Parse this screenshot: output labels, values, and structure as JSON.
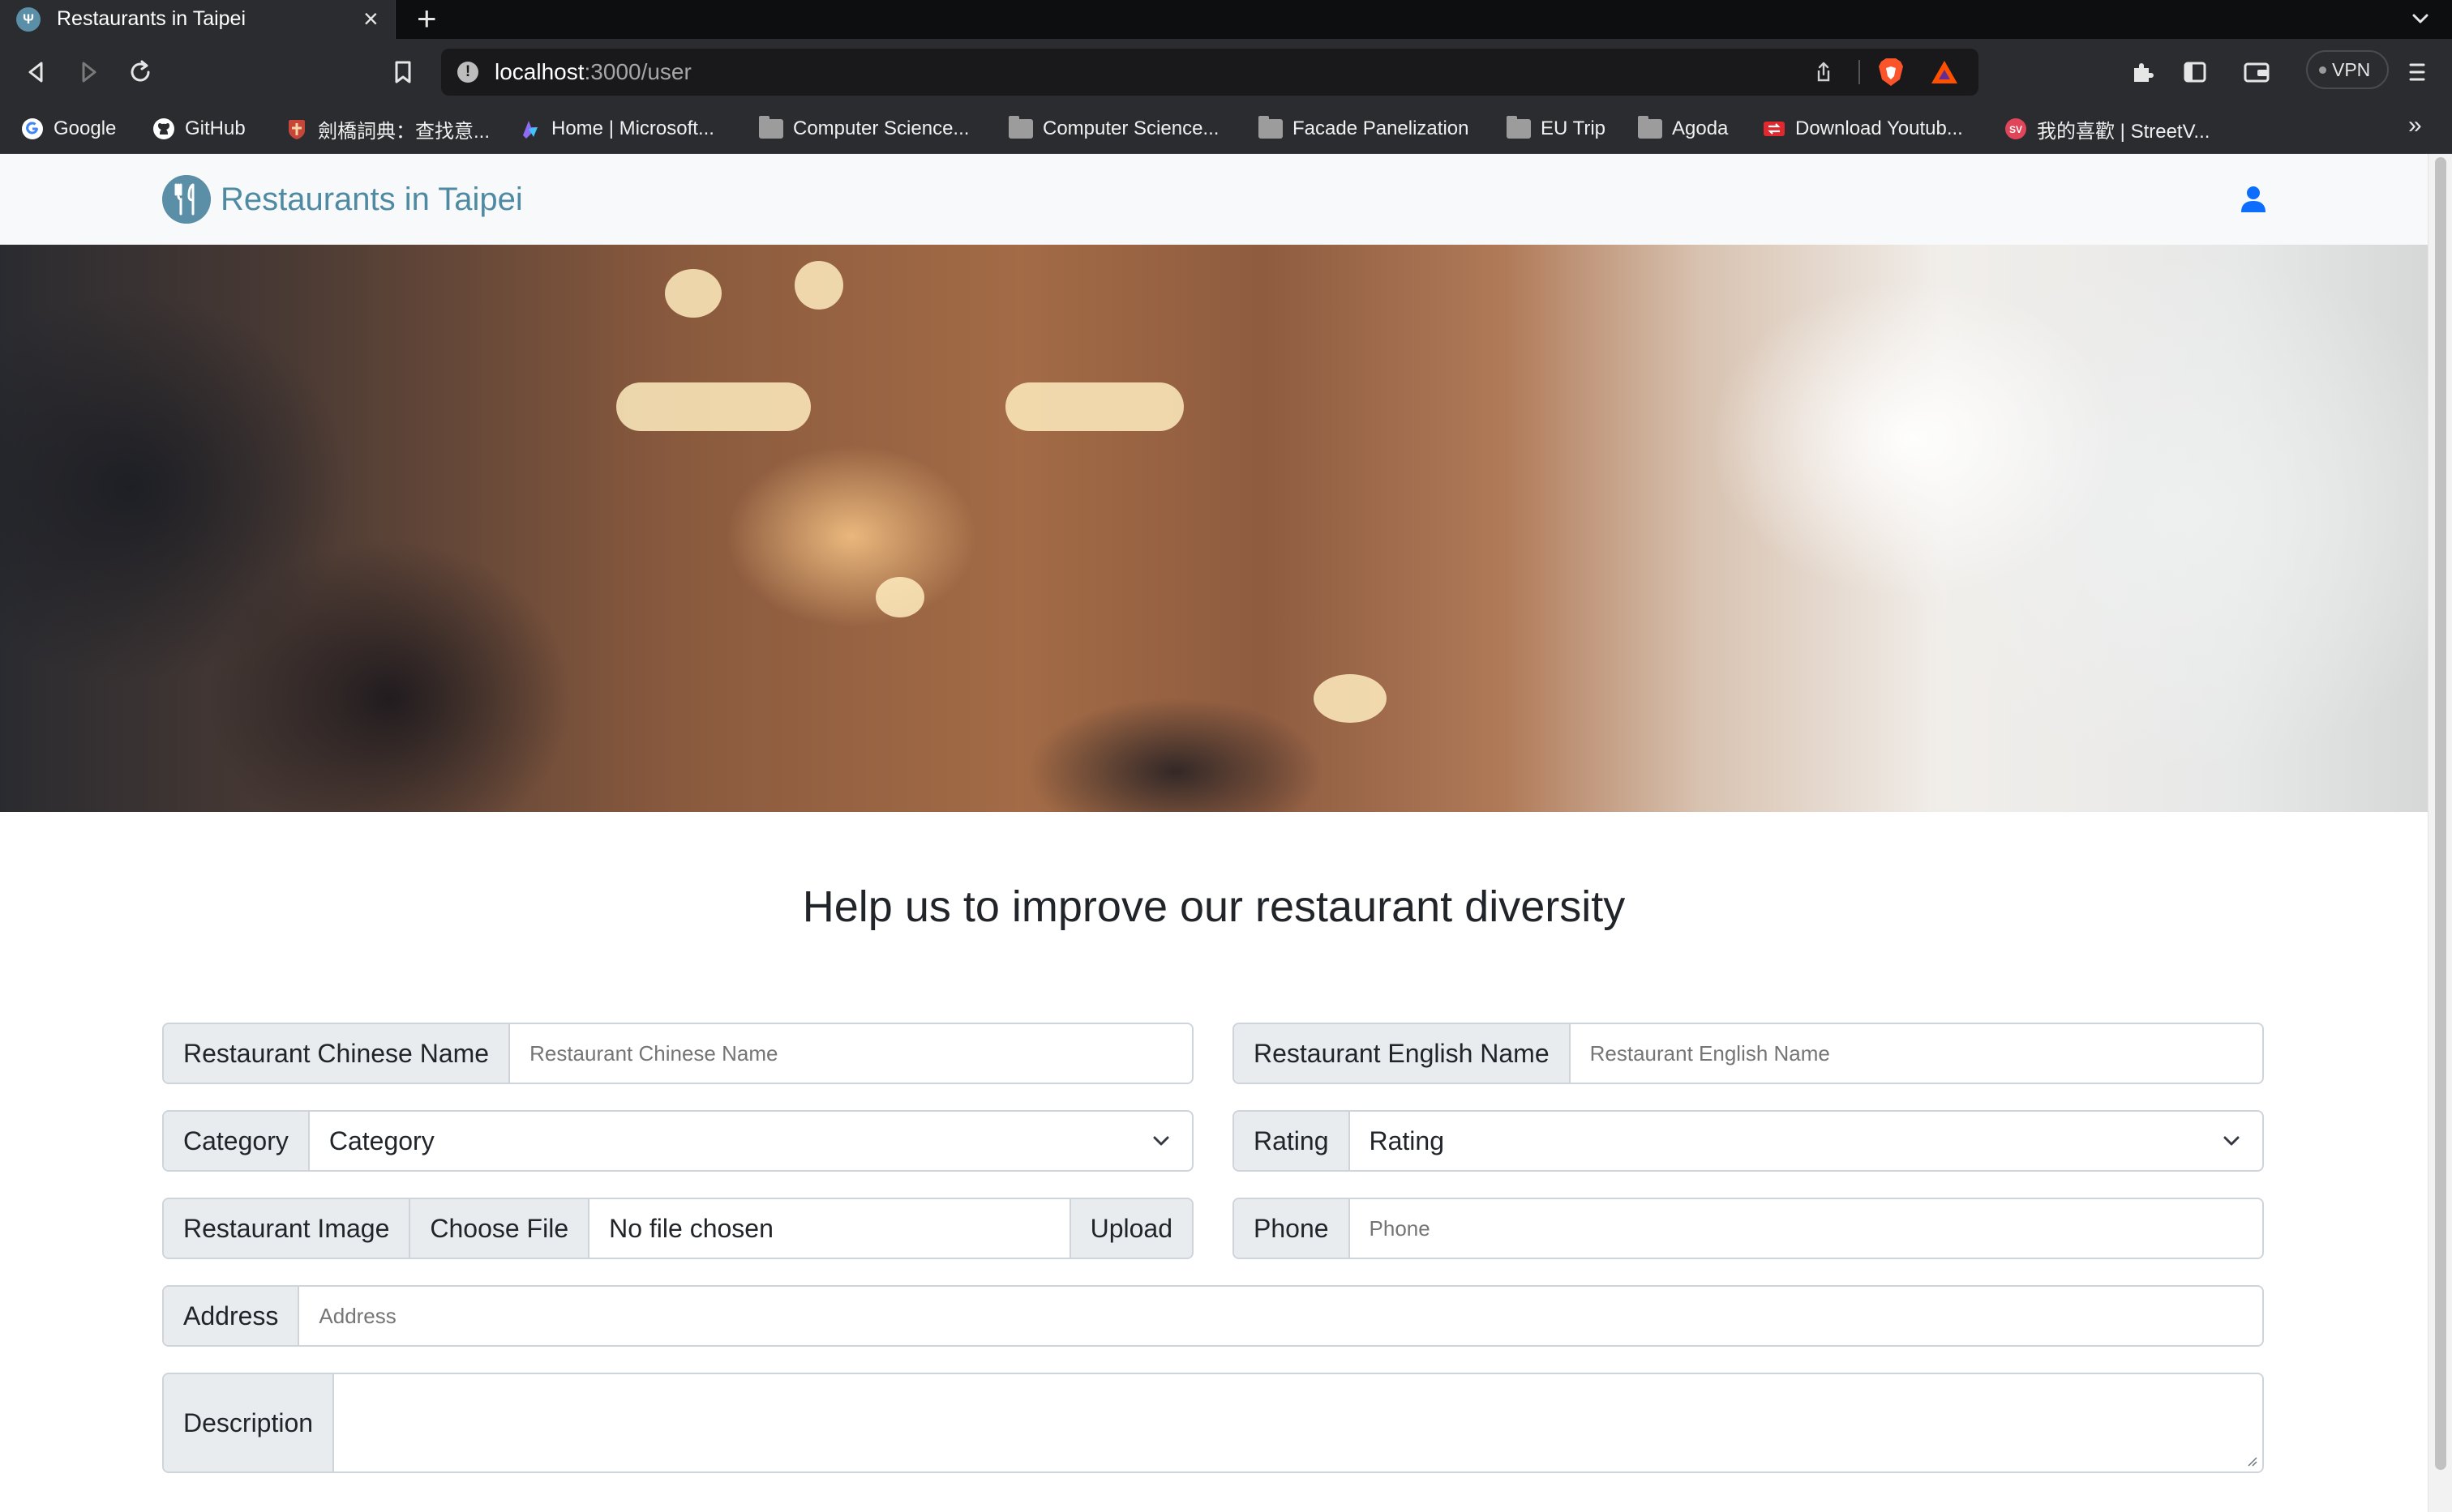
{
  "browser": {
    "tab_title": "Restaurants in Taipei",
    "url_host": "localhost",
    "url_path": ":3000/user",
    "vpn_label": "VPN",
    "bookmarks": [
      {
        "label": "Google",
        "icon": "google-icon"
      },
      {
        "label": "GitHub",
        "icon": "github-icon"
      },
      {
        "label": "劍橋詞典：查找意...",
        "icon": "cambridge-icon"
      },
      {
        "label": "Home | Microsoft...",
        "icon": "microsoft-icon"
      },
      {
        "label": "Computer Science...",
        "icon": "folder-icon"
      },
      {
        "label": "Computer Science...",
        "icon": "folder-icon"
      },
      {
        "label": "Facade Panelization",
        "icon": "folder-icon"
      },
      {
        "label": "EU Trip",
        "icon": "folder-icon"
      },
      {
        "label": "Agoda",
        "icon": "folder-icon"
      },
      {
        "label": "Download Youtub...",
        "icon": "download-icon"
      },
      {
        "label": "我的喜歡 | StreetV...",
        "icon": "streetvoice-icon"
      }
    ],
    "more_bookmarks": "»"
  },
  "navbar": {
    "brand": "Restaurants in Taipei",
    "brand_color": "#4f8aa3",
    "user_icon": "user-icon"
  },
  "banner": {
    "image": "blurred-restaurant-interior"
  },
  "form": {
    "heading": "Help us to improve our restaurant diversity",
    "chinese_name": {
      "label": "Restaurant Chinese Name",
      "placeholder": "Restaurant Chinese Name"
    },
    "english_name": {
      "label": "Restaurant English Name",
      "placeholder": "Restaurant English Name"
    },
    "category": {
      "label": "Category",
      "value": "Category"
    },
    "rating": {
      "label": "Rating",
      "value": "Rating"
    },
    "image": {
      "label": "Restaurant Image",
      "choose": "Choose File",
      "filename": "No file chosen",
      "upload": "Upload"
    },
    "phone": {
      "label": "Phone",
      "placeholder": "Phone"
    },
    "address": {
      "label": "Address",
      "placeholder": "Address"
    },
    "description": {
      "label": "Description"
    }
  }
}
